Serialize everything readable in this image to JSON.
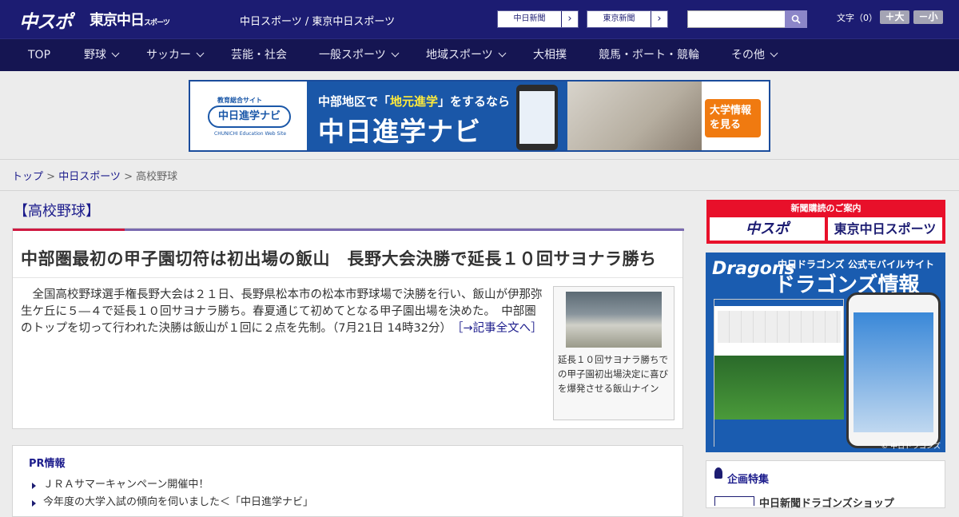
{
  "header": {
    "logo_chusupo": "中スポ",
    "logo_tokyo": "東京中日",
    "logo_tokyo_sub": "スポーツ",
    "site_name": "中日スポーツ / 東京中日スポーツ",
    "ext_chunichi": "中日新聞",
    "ext_tokyo": "東京新聞",
    "ext_arrow": "›",
    "text_size_label": "文字（0）",
    "size_up": "＋大",
    "size_down": "－小",
    "search_placeholder": ""
  },
  "nav": {
    "items": [
      {
        "label": "TOP",
        "chevron": false
      },
      {
        "label": "野球",
        "chevron": true
      },
      {
        "label": "サッカー",
        "chevron": true
      },
      {
        "label": "芸能・社会",
        "chevron": false
      },
      {
        "label": "一般スポーツ",
        "chevron": true
      },
      {
        "label": "地域スポーツ",
        "chevron": true
      },
      {
        "label": "大相撲",
        "chevron": false
      },
      {
        "label": "競馬・ボート・競輪",
        "chevron": false
      },
      {
        "label": "その他",
        "chevron": true
      }
    ]
  },
  "banner": {
    "edu_label": "教育総合サイト",
    "logo_text": "中日進学ナビ",
    "logo_sub": "CHUNICHI Education Web Site",
    "line1_pre": "中部地区で「",
    "line1_highlight": "地元進学",
    "line1_post": "」をするなら",
    "line2": "中日進学ナビ",
    "cta": "大学情報を見る"
  },
  "breadcrumb": {
    "top": "トップ",
    "sep": " > ",
    "section": "中日スポーツ",
    "current": "高校野球"
  },
  "section_title": "【高校野球】",
  "article": {
    "headline": "中部圏最初の甲子園切符は初出場の飯山　長野大会決勝で延長１０回サヨナラ勝ち",
    "body": "　全国高校野球選手権長野大会は２１日、長野県松本市の松本市野球場で決勝を行い、飯山が伊那弥生ケ丘に５―４で延長１０回サヨナラ勝ち。春夏通じて初めてとなる甲子園出場を決めた。　中部圏のトップを切って行われた決勝は飯山が１回に２点を先制。（7月21日 14時32分）",
    "read_more": "［→記事全文へ］",
    "caption": "延長１０回サヨナラ勝ちでの甲子園初出場決定に喜びを爆発させる飯山ナイン"
  },
  "pr": {
    "title": "PR情報",
    "items": [
      "ＪＲＡサマーキャンペーン開催中！",
      "今年度の大学入試の傾向を伺いました＜「中日進学ナビ」"
    ]
  },
  "sidebar": {
    "subscribe_title": "新聞購読のご案内",
    "sub_chusupo": "中スポ",
    "sub_tokyo": "東京中日スポーツ",
    "dragons_brand": "Dragons",
    "dragons_t1": "中日ドラゴンズ 公式モバイルサイト",
    "dragons_t2": "ドラゴンズ情報",
    "dragons_copy": "© 中日ドラゴンズ",
    "plan_title": "企画特集",
    "plan_item": "中日新聞ドラゴンズショップ"
  },
  "colors": {
    "header_bg": "#1c1c72",
    "nav_bg": "#151552",
    "link": "#1c1c8c",
    "accent_red": "#d01840",
    "subscribe_red": "#e8102a"
  }
}
